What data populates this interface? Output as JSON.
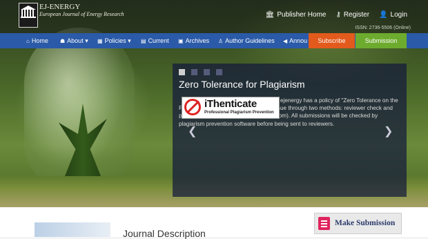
{
  "header": {
    "brand_title": "EJ-ENERGY",
    "brand_subtitle": "European Journal of Energy Research",
    "links": [
      {
        "icon": "building-icon",
        "label": "Publisher Home"
      },
      {
        "icon": "key-icon",
        "label": "Register"
      },
      {
        "icon": "user-icon",
        "label": "Login"
      }
    ],
    "issn": "ISSN: 2736-5506 (Online)"
  },
  "nav": {
    "items": [
      {
        "icon": "home-icon",
        "label": "Home"
      },
      {
        "icon": "sitemap-icon",
        "label": "About ▾"
      },
      {
        "icon": "calendar-icon",
        "label": "Policies ▾"
      },
      {
        "icon": "file-icon",
        "label": "Current"
      },
      {
        "icon": "archive-icon",
        "label": "Archives"
      },
      {
        "icon": "person-icon",
        "label": "Author Guidelines"
      },
      {
        "icon": "megaphone-icon",
        "label": "Annou"
      }
    ],
    "subscribe": "Subscribe",
    "submission": "Submission"
  },
  "slider": {
    "active_index": 0,
    "title": "Zero Tolerance for Plagiarism",
    "logo_text": "iThenticate",
    "logo_sub": "Professional Plagiarism Prevention",
    "logo_badge": "PLAGIARISM",
    "body": "ejenergy has a policy of \"Zero Tolerance on the Plagiarism\". We check the plagiarism issue through two methods: reviewer check and plagiarism prevention tool (iThenticate.com). All submissions will be checked by plagiarism prevention software before being sent to reviewers."
  },
  "main": {
    "journal_description": "Journal Description",
    "make_submission": "Make Submission"
  }
}
